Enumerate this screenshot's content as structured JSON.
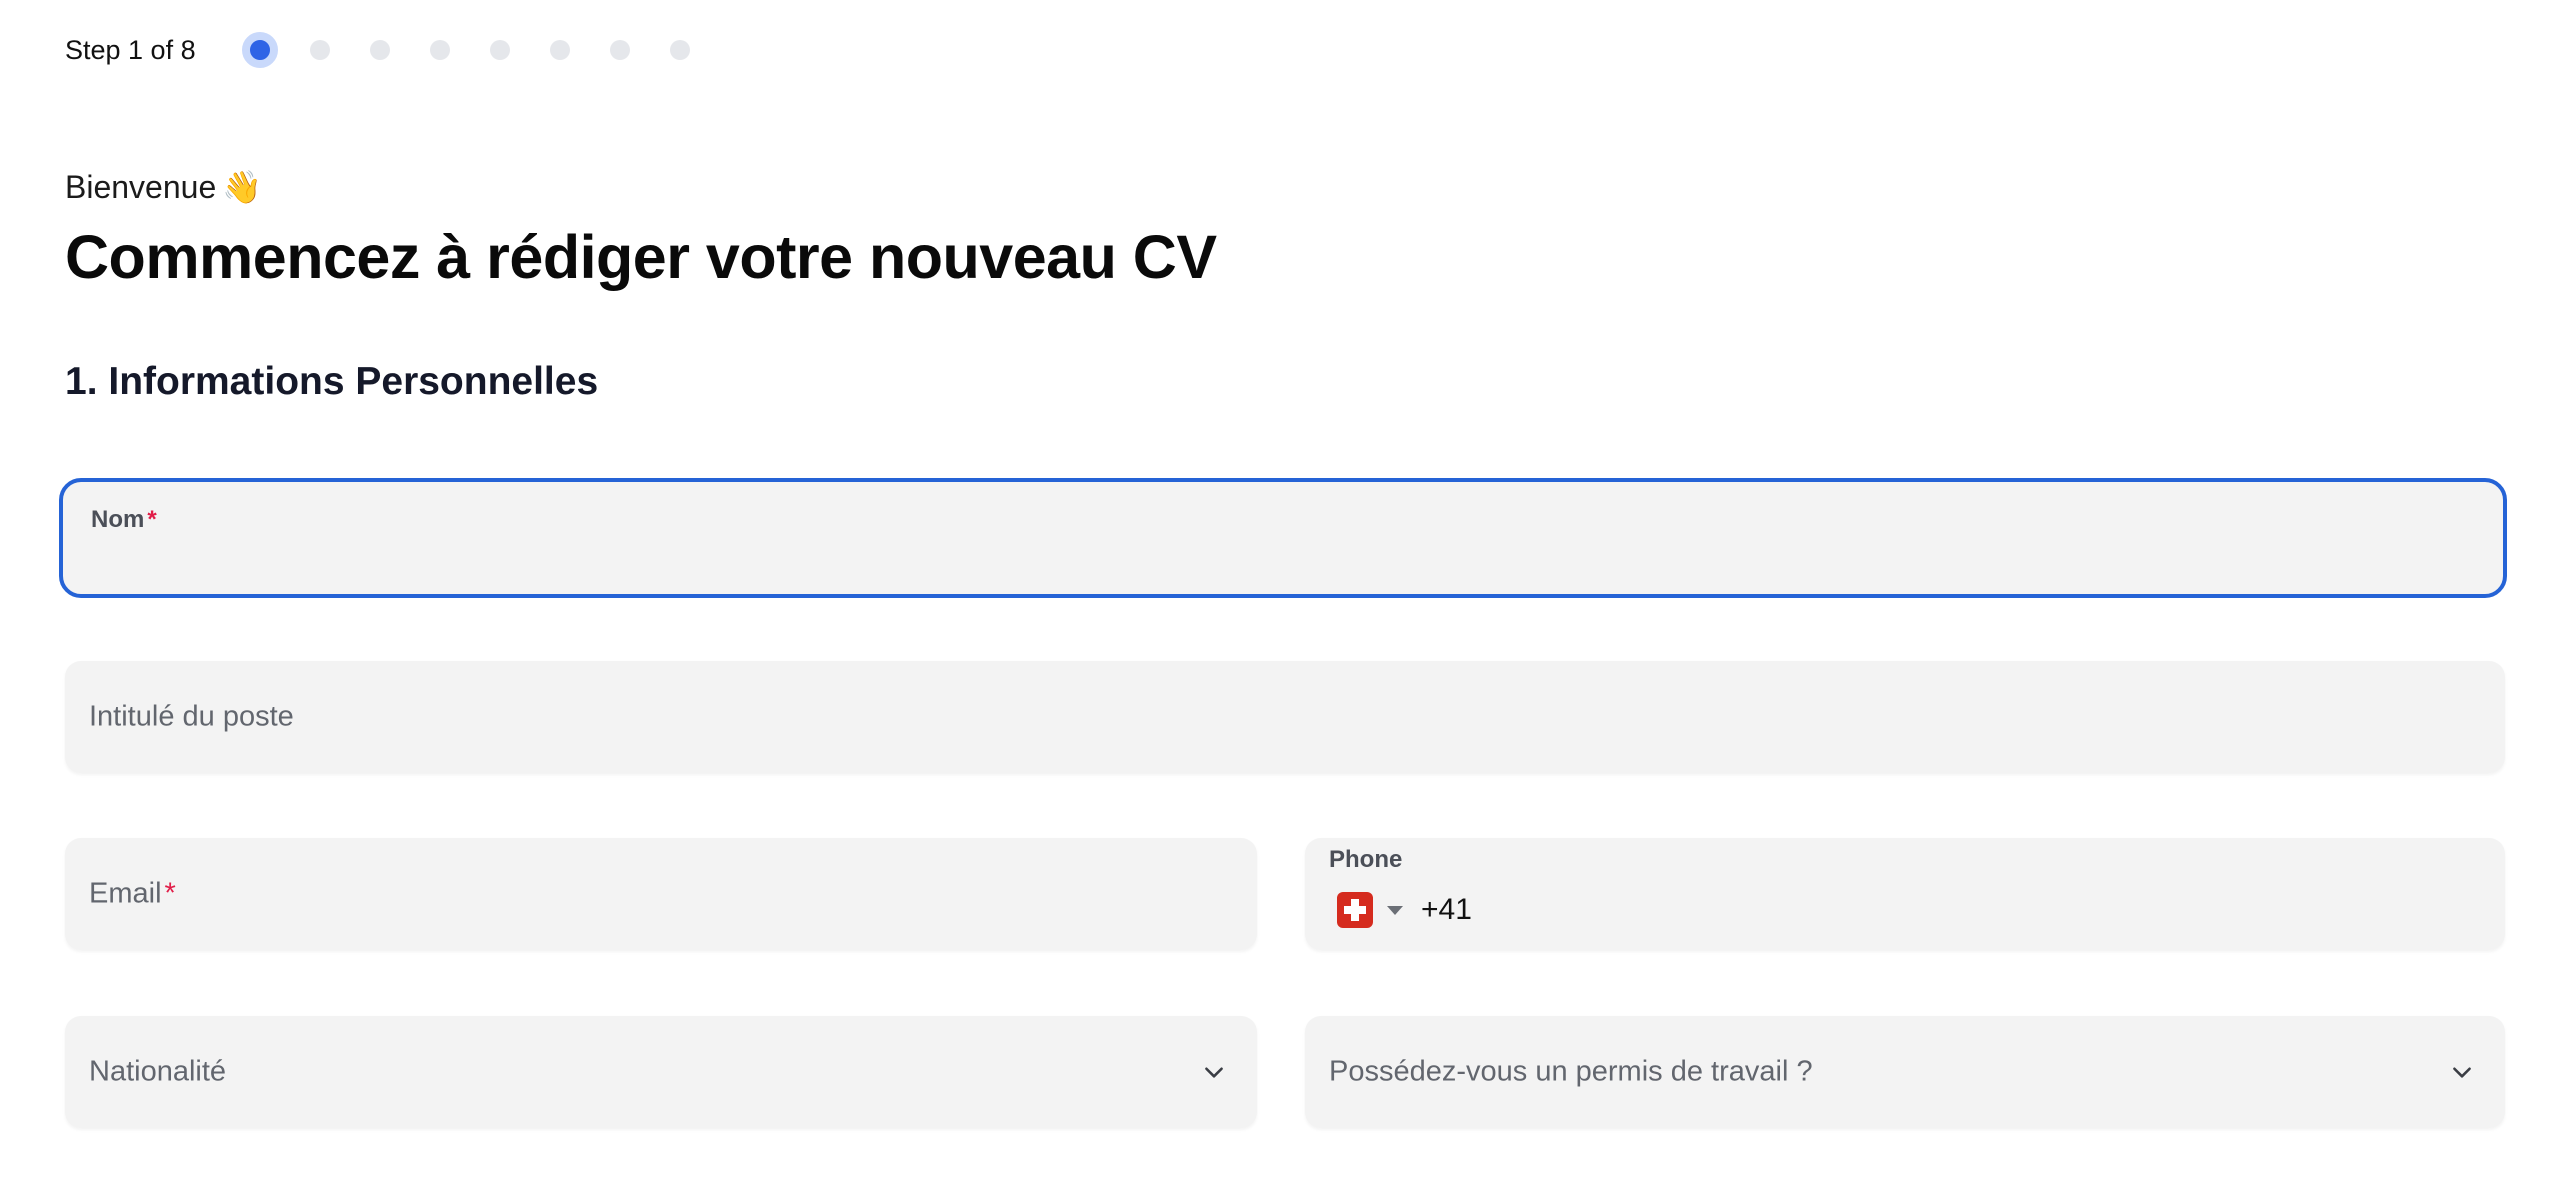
{
  "progress": {
    "label": "Step 1 of 8",
    "current_step": 1,
    "total_steps": 8
  },
  "header": {
    "greeting": "Bienvenue",
    "greeting_emoji": "👋",
    "title": "Commencez à rédiger votre nouveau CV"
  },
  "section": {
    "title": "1. Informations Personnelles"
  },
  "form": {
    "nom": {
      "label": "Nom",
      "required_mark": "*",
      "value": ""
    },
    "job_title": {
      "placeholder": "Intitulé du poste",
      "value": ""
    },
    "email": {
      "placeholder": "Email",
      "required_mark": "*",
      "value": ""
    },
    "phone": {
      "label": "Phone",
      "country_flag": "switzerland-flag-icon",
      "dial_code": "+41"
    },
    "nationality": {
      "placeholder": "Nationalité",
      "icon": "chevron-down-icon"
    },
    "work_permit": {
      "placeholder": "Possédez-vous un permis de travail ?",
      "icon": "chevron-down-icon"
    }
  },
  "colors": {
    "accent": "#2563d6",
    "active_dot": "#2f64e6",
    "active_dot_ring": "#c9d9fb",
    "inactive_dot": "#e5e7eb",
    "field_bg": "#f3f3f3",
    "required": "#e11d48"
  }
}
